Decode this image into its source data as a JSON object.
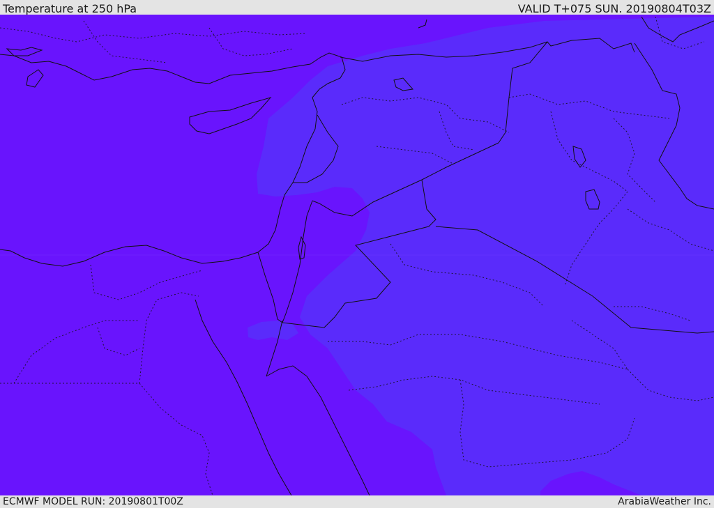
{
  "header": {
    "title": "Temperature at 250 hPa",
    "valid_time": "VALID T+075 SUN. 20190804T03Z"
  },
  "footer": {
    "model_run": "ECMWF MODEL RUN: 20190801T00Z",
    "credit": "ArabiaWeather Inc."
  },
  "map": {
    "field": "temperature",
    "level": "250 hPa",
    "colors": {
      "cold_fill": "#6914fd",
      "warm_fill": "#5a2bfb",
      "coastline": "#111111",
      "borders": "#111111"
    }
  }
}
